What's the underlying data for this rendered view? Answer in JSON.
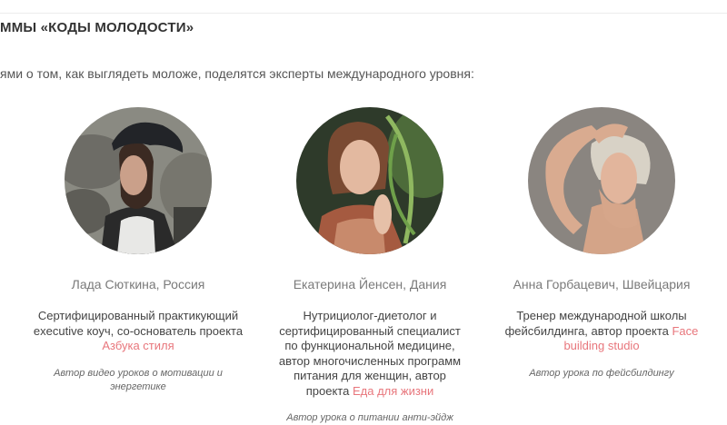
{
  "section": {
    "heading": "ММЫ «КОДЫ МОЛОДОСТИ»",
    "intro": "ями о том, как выглядеть моложе, поделятся эксперты международного уровня:"
  },
  "experts": [
    {
      "name": "Лада Сюткина, Россия",
      "description": "Сертифицированный практикующий executive коуч, со-основатель проекта",
      "project_link": "Азбука стиля",
      "note": "Автор видео уроков о мотивации и энергетике",
      "photo_icon": "portrait-photo"
    },
    {
      "name": "Екатерина Йенсен, Дания",
      "description": "Нутрициолог-диетолог и сертифицированный специалист по функциональной медицине, автор многочисленных программ питания для женщин, автор проекта",
      "project_link": "Еда для жизни",
      "note": "Автор урока о питании анти-эйдж",
      "photo_icon": "portrait-photo"
    },
    {
      "name": "Анна Горбацевич, Швейцария",
      "description": "Тренер международной школы фейсбилдинга, автор проекта",
      "project_link": "Face building studio",
      "note": "Автор урока по фейсбилдингу",
      "photo_icon": "portrait-photo"
    }
  ],
  "colors": {
    "link": "#e8767c",
    "heading": "#333333",
    "name": "#7a7a7a"
  }
}
